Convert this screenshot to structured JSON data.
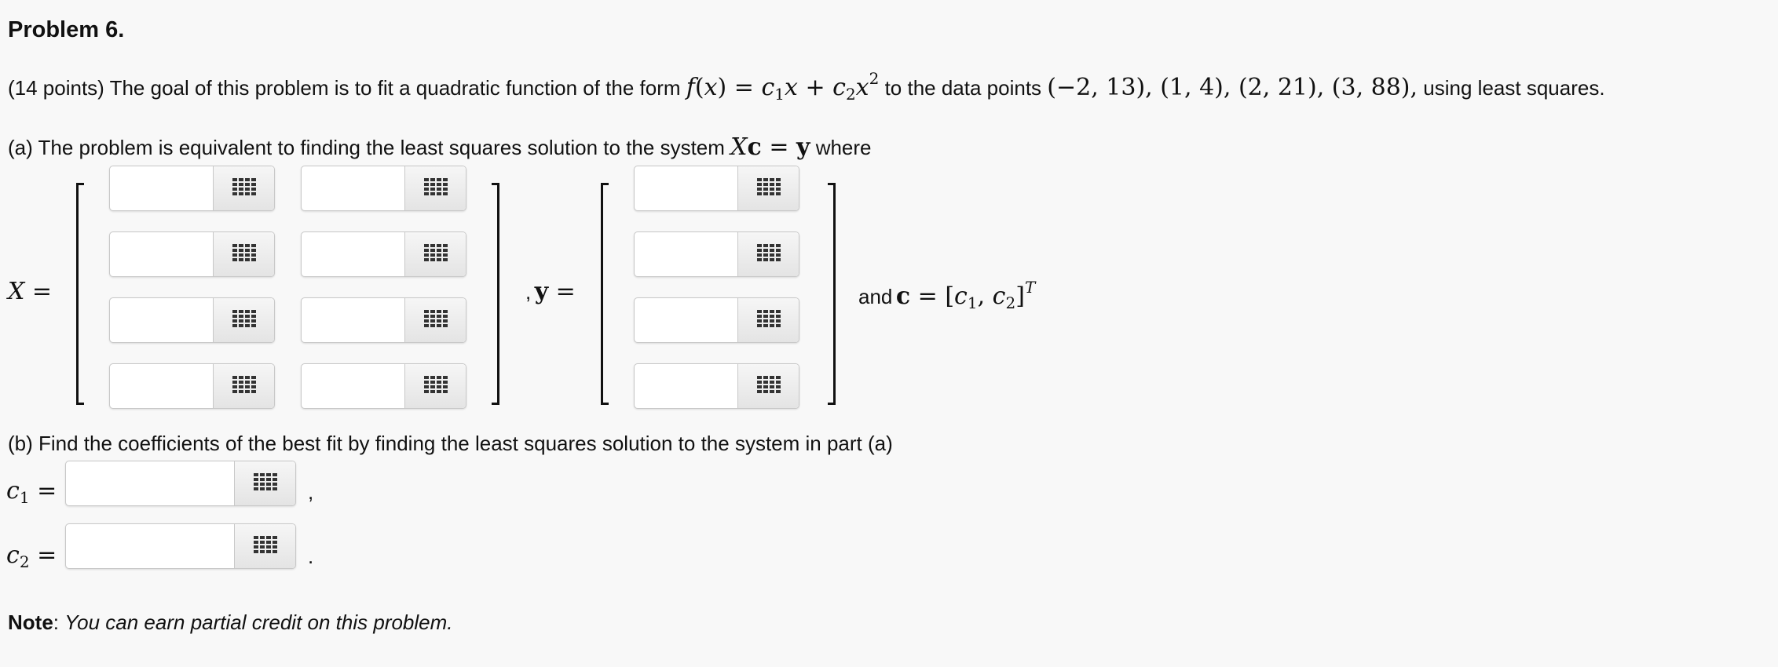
{
  "title": "Problem 6.",
  "intro": {
    "text_before": "(14 points) The goal of this problem is to fit a quadratic function of the form",
    "function": "f(x) = c₁x + c₂x²",
    "text_middle": "to the data points",
    "points": "(−2, 13), (1, 4), (2, 21), (3, 88),",
    "text_after": "using least squares."
  },
  "part_a": {
    "text": "(a) The problem is equivalent to finding the least squares solution to the system",
    "system": "Xc = y",
    "where": "where",
    "x_label": "X =",
    "y_label": ", y =",
    "and_text": "and",
    "c_def": "c = [c₁, c₂]",
    "c_def_sup": "T",
    "matrix_X_rows": 4,
    "matrix_X_cols": 2,
    "vector_y_rows": 4,
    "input_values": "",
    "entry_icon": "matrix-grid-icon"
  },
  "part_b": {
    "text": "(b) Find the coefficients of the best fit by finding the least squares solution to the system in part (a)",
    "c1_label": "c₁ =",
    "c1_value": "",
    "c1_punct": ",",
    "c2_label": "c₂ =",
    "c2_value": "",
    "c2_punct": "."
  },
  "note": {
    "label": "Note",
    "text": "You can earn partial credit on this problem."
  }
}
